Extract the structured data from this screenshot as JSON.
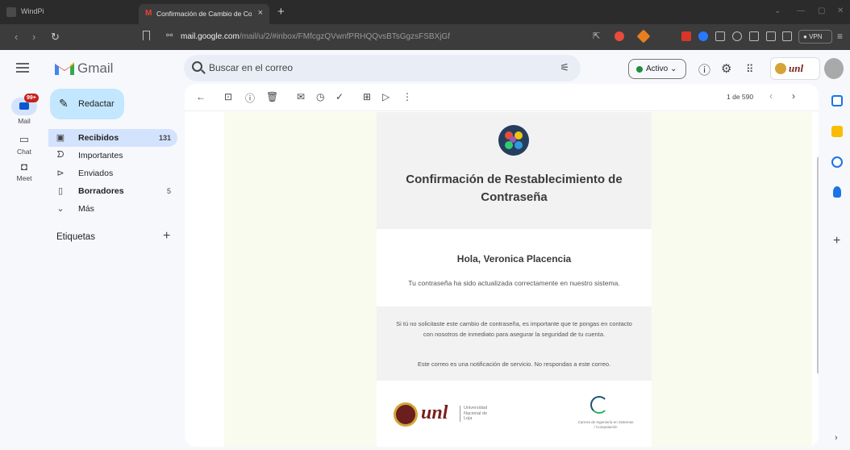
{
  "browser": {
    "app_name": "WindPi",
    "tab_title": "Confirmación de Cambio de Co",
    "url_domain": "mail.google.com",
    "url_path": "/mail/u/2/#inbox/FMfcgzQVwnfPRHQQvsBTsGgzsFSBXjGf",
    "vpn_label": "VPN"
  },
  "gmail": {
    "product_name": "Gmail",
    "search_placeholder": "Buscar en el correo",
    "status_label": "Activo"
  },
  "rail": {
    "mail": "Mail",
    "mail_badge": "99+",
    "chat": "Chat",
    "meet": "Meet"
  },
  "nav": {
    "compose": "Redactar",
    "items": [
      {
        "label": "Recibidos",
        "count": "131"
      },
      {
        "label": "Importantes",
        "count": ""
      },
      {
        "label": "Enviados",
        "count": ""
      },
      {
        "label": "Borradores",
        "count": "5"
      },
      {
        "label": "Más",
        "count": ""
      }
    ],
    "labels_title": "Etiquetas"
  },
  "toolbar": {
    "pager": "1 de 590"
  },
  "email": {
    "title": "Confirmación de Restablecimiento de Contraseña",
    "greeting": "Hola, Veronica Placencia",
    "body": "Tu contraseña ha sido actualizada correctamente en nuestro sistema.",
    "warning": "Si tú no solicitaste este cambio de contraseña, es importante que te pongas en contacto con nosotros de inmediato para asegurar la seguridad de tu cuenta.",
    "notice": "Este correo es una notificación de servicio. No respondas a este correo.",
    "footer_logo_left": "unl",
    "footer_logo_left_sub": "Universidad Nacional de Loja",
    "footer_logo_right_sub": "Carrera de Ingeniería en Sistemas / Computación"
  },
  "colors": {
    "accent": "#0b57d0",
    "compose_bg": "#c2e7ff",
    "active_nav": "#d3e3fd",
    "badge": "#c5221f",
    "status_green": "#1e8e3e"
  }
}
